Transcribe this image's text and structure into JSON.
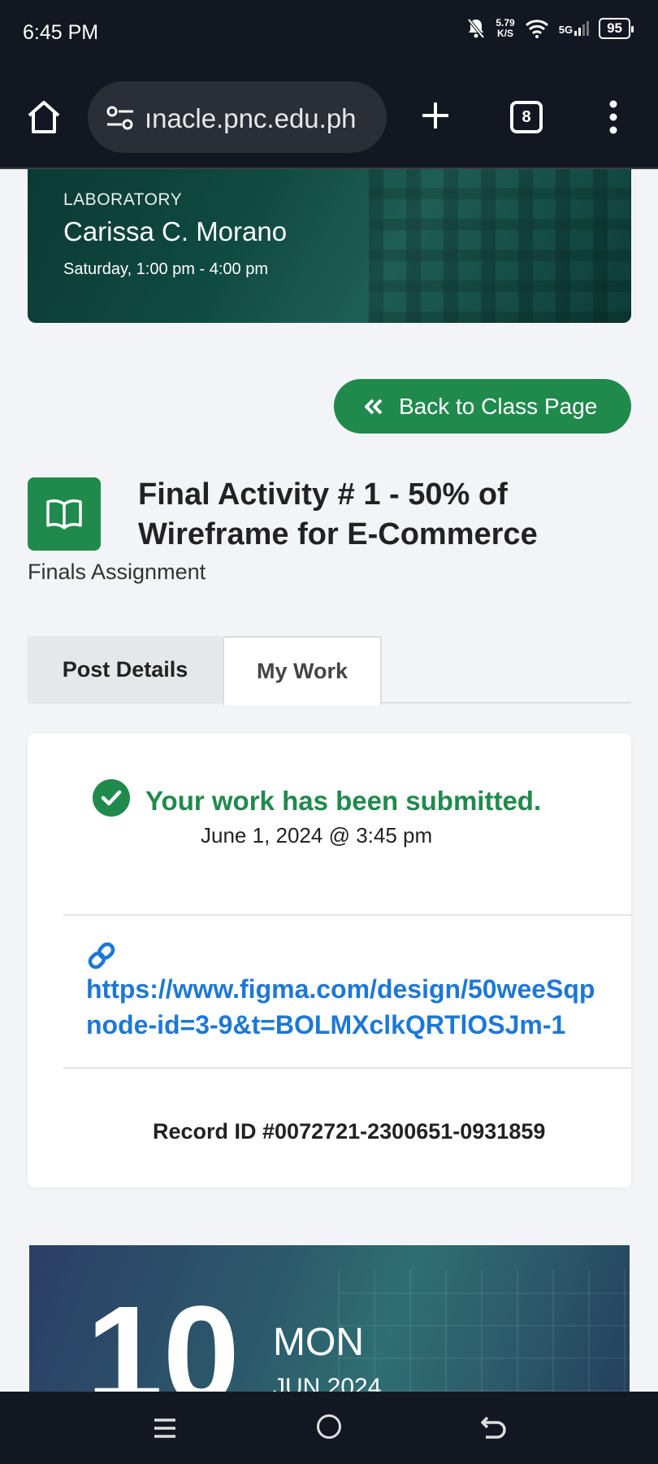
{
  "status_bar": {
    "time": "6:45 PM",
    "net_speed_value": "5.79",
    "net_speed_unit": "K/S",
    "network_type": "5G",
    "battery": "95"
  },
  "browser": {
    "url": "ınacle.pnc.edu.ph",
    "tab_count": "8"
  },
  "banner": {
    "label": "LABORATORY",
    "instructor": "Carissa C. Morano",
    "schedule": "Saturday, 1:00 pm - 4:00 pm"
  },
  "back_button": "Back to Class Page",
  "post": {
    "title": "Final Activity # 1 - 50% of Wireframe for E-Commerce",
    "subtitle": "Finals Assignment"
  },
  "tabs": [
    {
      "label": "Post Details",
      "active": false
    },
    {
      "label": "My Work",
      "active": true
    }
  ],
  "submission": {
    "status": "Your work has been submitted.",
    "date": "June 1, 2024 @ 3:45 pm",
    "link": "https://www.figma.com/design/50weeSqp\nnode-id=3-9&t=BOLMXclkQRTlOSJm-1",
    "record_id": "Record ID #0072721-2300651-0931859"
  },
  "calendar": {
    "day": "10",
    "weekday": "MON",
    "month_year": "JUN 2024"
  },
  "colors": {
    "accent_green": "#1f8a4c",
    "link_blue": "#1d78d6",
    "system_bar": "#131722"
  }
}
